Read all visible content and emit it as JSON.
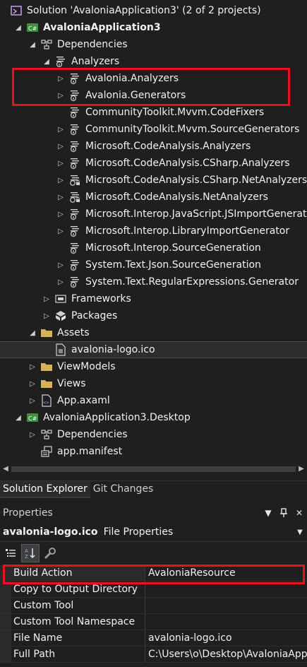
{
  "solution_explorer": {
    "rows": [
      {
        "text": "Solution 'AvaloniaApplication3' (2 of 2 projects)",
        "indent": 0,
        "expander": "",
        "icon": "solution-icon",
        "bold": false
      },
      {
        "text": "AvaloniaApplication3",
        "indent": 1,
        "expander": "▲",
        "icon": "csharp-project-icon",
        "bold": true
      },
      {
        "text": "Dependencies",
        "indent": 2,
        "expander": "▲",
        "icon": "dependencies-icon",
        "bold": false
      },
      {
        "text": "Analyzers",
        "indent": 3,
        "expander": "▲",
        "icon": "analyzer-icon",
        "bold": false
      },
      {
        "text": "Avalonia.Analyzers",
        "indent": 4,
        "expander": "▷",
        "icon": "analyzer-icon",
        "bold": false
      },
      {
        "text": "Avalonia.Generators",
        "indent": 4,
        "expander": "▷",
        "icon": "analyzer-icon",
        "bold": false
      },
      {
        "text": "CommunityToolkit.Mvvm.CodeFixers",
        "indent": 4,
        "expander": "",
        "icon": "analyzer-icon",
        "bold": false
      },
      {
        "text": "CommunityToolkit.Mvvm.SourceGenerators",
        "indent": 4,
        "expander": "▷",
        "icon": "analyzer-icon",
        "bold": false
      },
      {
        "text": "Microsoft.CodeAnalysis.Analyzers",
        "indent": 4,
        "expander": "▷",
        "icon": "analyzer-icon",
        "bold": false
      },
      {
        "text": "Microsoft.CodeAnalysis.CSharp.Analyzers",
        "indent": 4,
        "expander": "▷",
        "icon": "analyzer-icon",
        "bold": false
      },
      {
        "text": "Microsoft.CodeAnalysis.CSharp.NetAnalyzers",
        "indent": 4,
        "expander": "▷",
        "icon": "analyzer-lock-icon",
        "bold": false
      },
      {
        "text": "Microsoft.CodeAnalysis.NetAnalyzers",
        "indent": 4,
        "expander": "▷",
        "icon": "analyzer-lock-icon",
        "bold": false
      },
      {
        "text": "Microsoft.Interop.JavaScript.JSImportGenerator",
        "indent": 4,
        "expander": "▷",
        "icon": "analyzer-icon",
        "bold": false
      },
      {
        "text": "Microsoft.Interop.LibraryImportGenerator",
        "indent": 4,
        "expander": "▷",
        "icon": "analyzer-icon",
        "bold": false
      },
      {
        "text": "Microsoft.Interop.SourceGeneration",
        "indent": 4,
        "expander": "",
        "icon": "analyzer-icon",
        "bold": false
      },
      {
        "text": "System.Text.Json.SourceGeneration",
        "indent": 4,
        "expander": "▷",
        "icon": "analyzer-icon",
        "bold": false
      },
      {
        "text": "System.Text.RegularExpressions.Generator",
        "indent": 4,
        "expander": "▷",
        "icon": "analyzer-icon",
        "bold": false
      },
      {
        "text": "Frameworks",
        "indent": 3,
        "expander": "▷",
        "icon": "frameworks-icon",
        "bold": false
      },
      {
        "text": "Packages",
        "indent": 3,
        "expander": "▷",
        "icon": "packages-icon",
        "bold": false
      },
      {
        "text": "Assets",
        "indent": 2,
        "expander": "▲",
        "icon": "folder-icon",
        "bold": false
      },
      {
        "text": "avalonia-logo.ico",
        "indent": 3,
        "expander": "",
        "icon": "ico-file-icon",
        "bold": false,
        "selected": true
      },
      {
        "text": "ViewModels",
        "indent": 2,
        "expander": "▷",
        "icon": "folder-icon",
        "bold": false
      },
      {
        "text": "Views",
        "indent": 2,
        "expander": "▷",
        "icon": "folder-icon",
        "bold": false
      },
      {
        "text": "App.axaml",
        "indent": 2,
        "expander": "▷",
        "icon": "axaml-file-icon",
        "bold": false
      },
      {
        "text": "AvaloniaApplication3.Desktop",
        "indent": 1,
        "expander": "▲",
        "icon": "csharp-project-icon",
        "bold": false
      },
      {
        "text": "Dependencies",
        "indent": 2,
        "expander": "▷",
        "icon": "dependencies-icon",
        "bold": false
      },
      {
        "text": "app.manifest",
        "indent": 2,
        "expander": "",
        "icon": "manifest-icon",
        "bold": false
      }
    ]
  },
  "tabs": [
    {
      "label": "Solution Explorer",
      "active": true
    },
    {
      "label": "Git Changes",
      "active": false
    }
  ],
  "properties": {
    "title": "Properties",
    "object_name": "avalonia-logo.ico",
    "object_kind": "File Properties",
    "rows": [
      {
        "name": "Build Action",
        "value": "AvaloniaResource"
      },
      {
        "name": "Copy to Output Directory",
        "value": ""
      },
      {
        "name": "Custom Tool",
        "value": ""
      },
      {
        "name": "Custom Tool Namespace",
        "value": ""
      },
      {
        "name": "File Name",
        "value": "avalonia-logo.ico"
      },
      {
        "name": "Full Path",
        "value": "C:\\Users\\o\\Desktop\\AvaloniaApp"
      }
    ]
  },
  "colors": {
    "background": "#1f1f1f",
    "highlight_box": "#e81123",
    "csharp_icon": "#3d8f3d",
    "folder_icon": "#d8b15f"
  }
}
